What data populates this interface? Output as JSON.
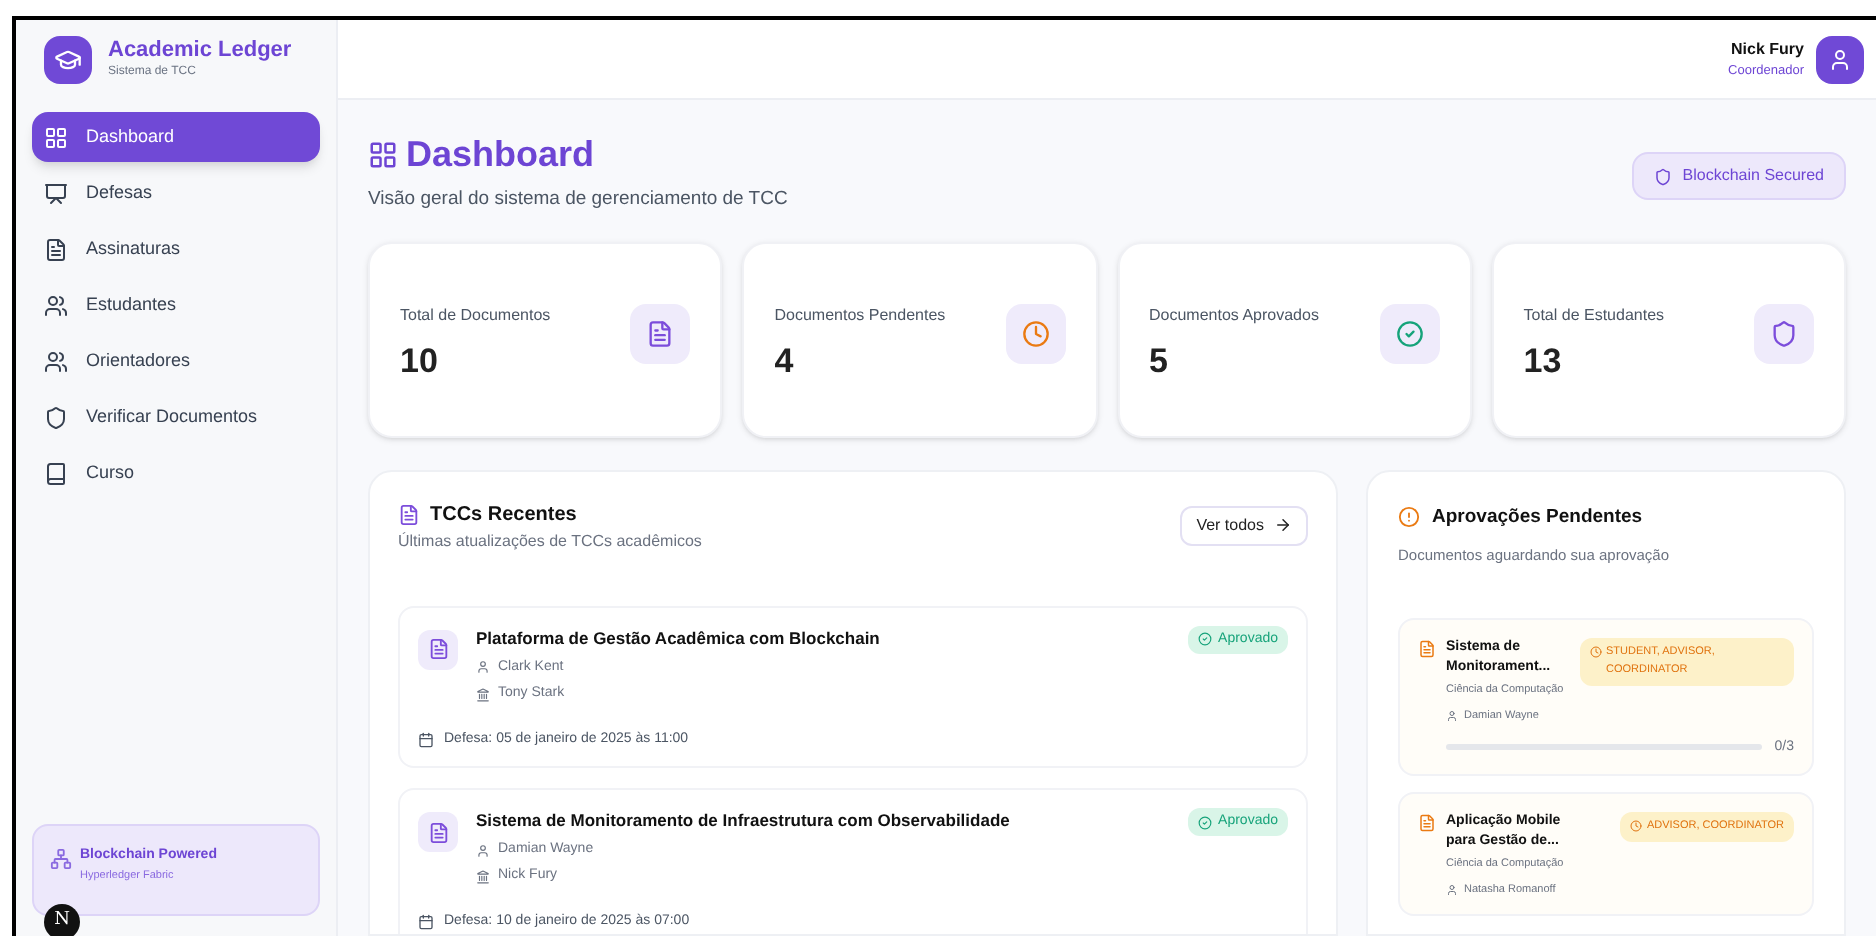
{
  "brand": {
    "title": "Academic Ledger",
    "subtitle": "Sistema de TCC"
  },
  "nav": [
    {
      "label": "Dashboard",
      "kind": "dashboard",
      "selected": true
    },
    {
      "label": "Defesas",
      "kind": "defenses",
      "selected": false
    },
    {
      "label": "Assinaturas",
      "kind": "signatures",
      "selected": false
    },
    {
      "label": "Estudantes",
      "kind": "people",
      "selected": false
    },
    {
      "label": "Orientadores",
      "kind": "people",
      "selected": false
    },
    {
      "label": "Verificar Documentos",
      "kind": "verify",
      "selected": false
    },
    {
      "label": "Curso",
      "kind": "course",
      "selected": false
    }
  ],
  "sidebar_footer": {
    "title": "Blockchain Powered",
    "subtitle": "Hyperledger Fabric"
  },
  "dev_badge": "N",
  "user": {
    "name": "Nick Fury",
    "role": "Coordenador"
  },
  "page": {
    "title": "Dashboard",
    "subtitle": "Visão geral do sistema de gerenciamento de TCC",
    "badge": "Blockchain Secured"
  },
  "stats": [
    {
      "label": "Total de Documentos",
      "value": "10",
      "kind": "documents"
    },
    {
      "label": "Documentos Pendentes",
      "value": "4",
      "kind": "pending"
    },
    {
      "label": "Documentos Aprovados",
      "value": "5",
      "kind": "approved"
    },
    {
      "label": "Total de Estudantes",
      "value": "13",
      "kind": "students"
    }
  ],
  "recent": {
    "title": "TCCs Recentes",
    "subtitle": "Últimas atualizações de TCCs acadêmicos",
    "button": "Ver todos",
    "items": [
      {
        "title": "Plataforma de Gestão Acadêmica com Blockchain",
        "student": "Clark Kent",
        "advisor": "Tony Stark",
        "status": "Aprovado",
        "date": "Defesa: 05 de janeiro de 2025 às 11:00"
      },
      {
        "title": "Sistema de Monitoramento de Infraestrutura com Observabilidade",
        "student": "Damian Wayne",
        "advisor": "Nick Fury",
        "status": "Aprovado",
        "date": "Defesa: 10 de janeiro de 2025 às 07:00"
      }
    ]
  },
  "pending": {
    "title": "Aprovações Pendentes",
    "subtitle": "Documentos aguardando sua aprovação",
    "items": [
      {
        "title": "Sistema de Monitorament...",
        "course": "Ciência da Computação",
        "student": "Damian Wayne",
        "roles": "STUDENT, ADVISOR, COORDINATOR",
        "level": 0,
        "count": "0/3"
      },
      {
        "title": "Aplicação Mobile para Gestão de...",
        "course": "Ciência da Computação",
        "student": "Natasha Romanoff",
        "roles": "ADVISOR, COORDINATOR"
      }
    ]
  }
}
